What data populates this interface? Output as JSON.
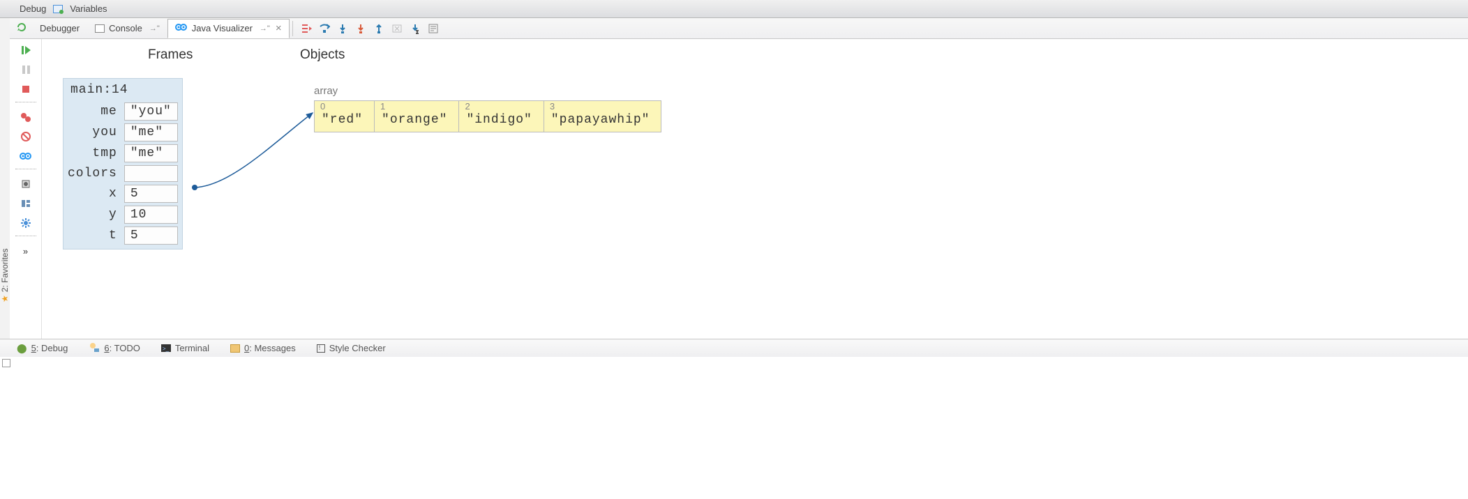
{
  "top": {
    "debug": "Debug",
    "variables": "Variables"
  },
  "tabs": {
    "debugger": "Debugger",
    "console": "Console",
    "pin": "→\"",
    "visualizer": "Java Visualizer",
    "close": "×"
  },
  "favorites": "2: Favorites",
  "headers": {
    "frames": "Frames",
    "objects": "Objects"
  },
  "frame": {
    "title": "main:14",
    "rows": [
      {
        "k": "me",
        "v": "\"you\""
      },
      {
        "k": "you",
        "v": "\"me\""
      },
      {
        "k": "tmp",
        "v": "\"me\""
      },
      {
        "k": "colors",
        "v": ""
      },
      {
        "k": "x",
        "v": "5"
      },
      {
        "k": "y",
        "v": "10"
      },
      {
        "k": "t",
        "v": "5"
      }
    ]
  },
  "array": {
    "label": "array",
    "cells": [
      {
        "idx": "0",
        "val": "\"red\""
      },
      {
        "idx": "1",
        "val": "\"orange\""
      },
      {
        "idx": "2",
        "val": "\"indigo\""
      },
      {
        "idx": "3",
        "val": "\"papayawhip\""
      }
    ]
  },
  "bottom": {
    "debug": {
      "num": "5",
      "label": ": Debug"
    },
    "todo": {
      "num": "6",
      "label": ": TODO"
    },
    "terminal": "Terminal",
    "messages": {
      "num": "0",
      "label": ": Messages"
    },
    "style": "Style Checker"
  },
  "chev": "»"
}
